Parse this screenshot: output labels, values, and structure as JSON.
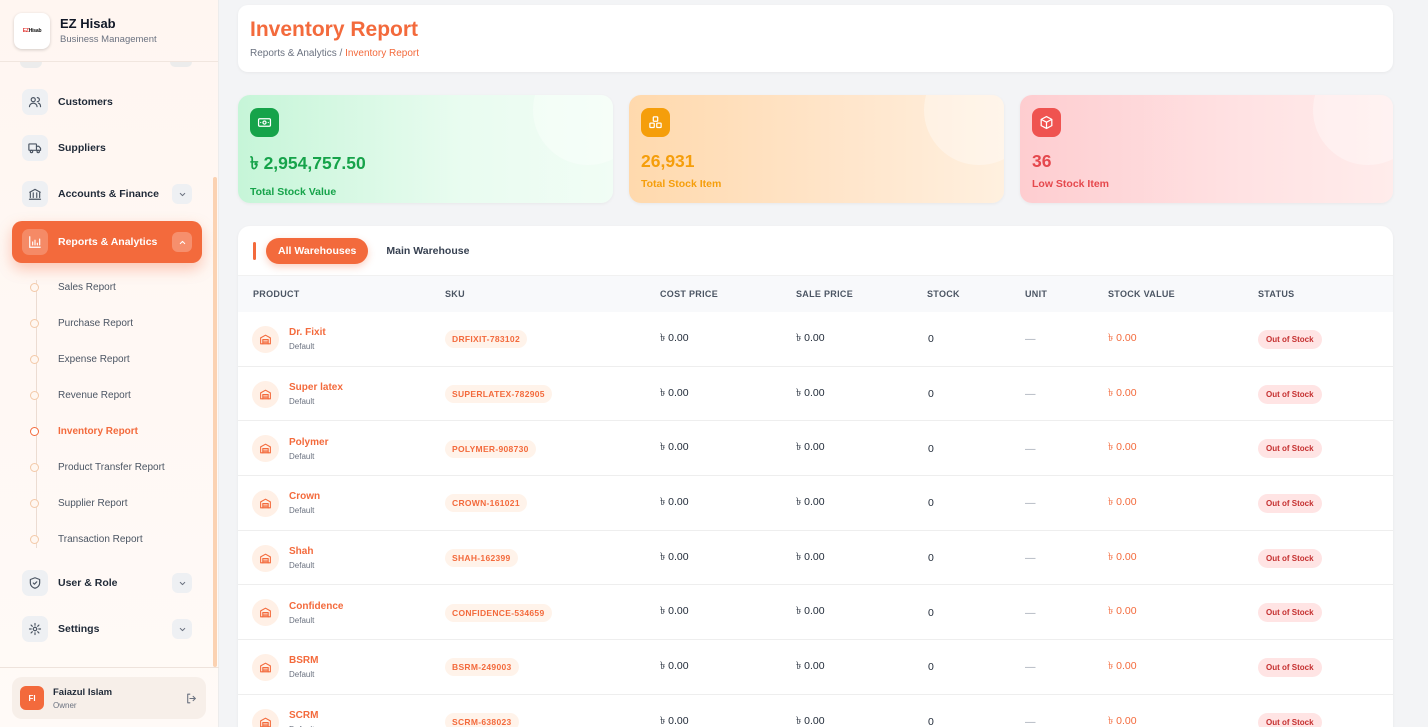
{
  "brand": {
    "name": "EZ Hisab",
    "subtitle": "Business Management",
    "logo_text_a": "EZ",
    "logo_text_b": "Hisab"
  },
  "sidebar": {
    "items": [
      {
        "label": "Customers",
        "icon": "users-icon"
      },
      {
        "label": "Suppliers",
        "icon": "truck-icon"
      },
      {
        "label": "Accounts & Finance",
        "icon": "bank-icon"
      },
      {
        "label": "Reports & Analytics",
        "icon": "bar-chart-icon"
      },
      {
        "label": "User & Role",
        "icon": "shield-icon"
      },
      {
        "label": "Settings",
        "icon": "gear-icon"
      }
    ],
    "subitems": [
      {
        "label": "Sales Report"
      },
      {
        "label": "Purchase Report"
      },
      {
        "label": "Expense Report"
      },
      {
        "label": "Revenue Report"
      },
      {
        "label": "Inventory Report"
      },
      {
        "label": "Product Transfer Report"
      },
      {
        "label": "Supplier Report"
      },
      {
        "label": "Transaction Report"
      }
    ]
  },
  "user": {
    "initials": "FI",
    "name": "Faiazul Islam",
    "role": "Owner"
  },
  "header": {
    "title": "Inventory Report",
    "crumb_parent": "Reports & Analytics",
    "crumb_sep": " / ",
    "crumb_current": "Inventory Report"
  },
  "stats": [
    {
      "value": "৳ 2,954,757.50",
      "label": "Total Stock Value",
      "color": "#16a34a"
    },
    {
      "value": "26,931",
      "label": "Total Stock Item",
      "color": "#f59e0b"
    },
    {
      "value": "36",
      "label": "Low Stock Item",
      "color": "#e5484d"
    }
  ],
  "tabs": [
    {
      "label": "All Warehouses"
    },
    {
      "label": "Main Warehouse"
    }
  ],
  "table": {
    "headers": [
      "PRODUCT",
      "SKU",
      "COST PRICE",
      "SALE PRICE",
      "STOCK",
      "UNIT",
      "STOCK VALUE",
      "STATUS"
    ],
    "rows": [
      {
        "name": "Dr. Fixit",
        "variant": "Default",
        "sku": "DRFIXIT-783102",
        "cost": "৳ 0.00",
        "sale": "৳ 0.00",
        "stock": "0",
        "unit": "—",
        "value": "৳ 0.00",
        "status": "Out of Stock"
      },
      {
        "name": "Super latex",
        "variant": "Default",
        "sku": "SUPERLATEX-782905",
        "cost": "৳ 0.00",
        "sale": "৳ 0.00",
        "stock": "0",
        "unit": "—",
        "value": "৳ 0.00",
        "status": "Out of Stock"
      },
      {
        "name": "Polymer",
        "variant": "Default",
        "sku": "POLYMER-908730",
        "cost": "৳ 0.00",
        "sale": "৳ 0.00",
        "stock": "0",
        "unit": "—",
        "value": "৳ 0.00",
        "status": "Out of Stock"
      },
      {
        "name": "Crown",
        "variant": "Default",
        "sku": "CROWN-161021",
        "cost": "৳ 0.00",
        "sale": "৳ 0.00",
        "stock": "0",
        "unit": "—",
        "value": "৳ 0.00",
        "status": "Out of Stock"
      },
      {
        "name": "Shah",
        "variant": "Default",
        "sku": "SHAH-162399",
        "cost": "৳ 0.00",
        "sale": "৳ 0.00",
        "stock": "0",
        "unit": "—",
        "value": "৳ 0.00",
        "status": "Out of Stock"
      },
      {
        "name": "Confidence",
        "variant": "Default",
        "sku": "CONFIDENCE-534659",
        "cost": "৳ 0.00",
        "sale": "৳ 0.00",
        "stock": "0",
        "unit": "—",
        "value": "৳ 0.00",
        "status": "Out of Stock"
      },
      {
        "name": "BSRM",
        "variant": "Default",
        "sku": "BSRM-249003",
        "cost": "৳ 0.00",
        "sale": "৳ 0.00",
        "stock": "0",
        "unit": "—",
        "value": "৳ 0.00",
        "status": "Out of Stock"
      },
      {
        "name": "SCRM",
        "variant": "Default",
        "sku": "SCRM-638023",
        "cost": "৳ 0.00",
        "sale": "৳ 0.00",
        "stock": "0",
        "unit": "—",
        "value": "৳ 0.00",
        "status": "Out of Stock"
      }
    ]
  },
  "colors": {
    "accent": "#f36a3c",
    "success": "#16a34a",
    "warning": "#f59e0b",
    "danger": "#e5484d"
  }
}
